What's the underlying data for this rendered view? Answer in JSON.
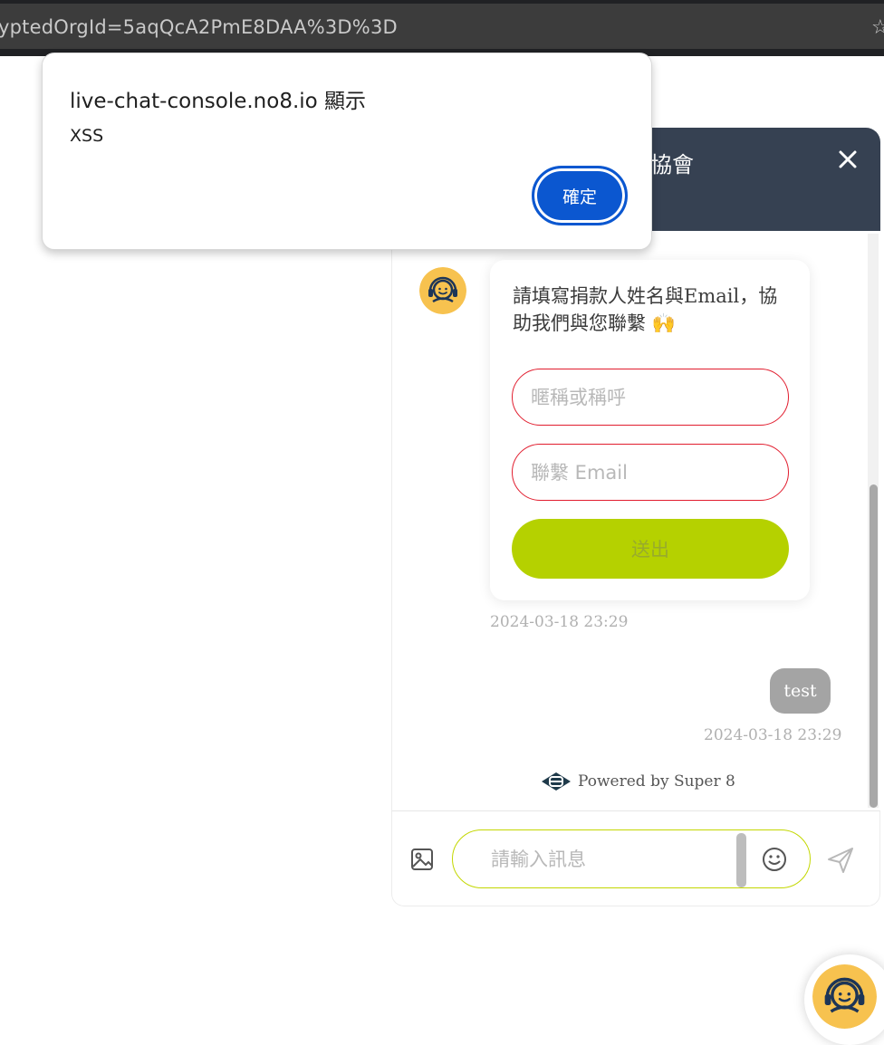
{
  "browser": {
    "url": "yptedOrgId=5aqQcA2PmE8DAA%3D%3D",
    "star_glyph": "☆"
  },
  "alert": {
    "title": "live-chat-console.no8.io 顯示",
    "message": "XSS",
    "ok_label": "確定"
  },
  "chat": {
    "header_title": "協會",
    "form_prompt": "請填寫捐款人姓名與Email，協助我們與您聯繫 🙌",
    "name_placeholder": "暱稱或稱呼",
    "email_placeholder": "聯繫 Email",
    "submit_label": "送出",
    "form_timestamp": "2024-03-18 23:29",
    "user_message": "test",
    "user_timestamp": "2024-03-18 23:29",
    "powered_by": "Powered by Super 8",
    "input_placeholder": "請輸入訊息"
  },
  "colors": {
    "header_bg": "#364152",
    "submit_bg": "#b5d100",
    "field_border": "#e11d2e",
    "accent_yellow": "#f7c24f",
    "dialog_button": "#0b57d0"
  },
  "icons": [
    "star-icon",
    "close-icon",
    "agent-avatar-icon",
    "image-icon",
    "emoji-icon",
    "send-icon",
    "super8-logo-icon",
    "chat-launcher-icon"
  ]
}
